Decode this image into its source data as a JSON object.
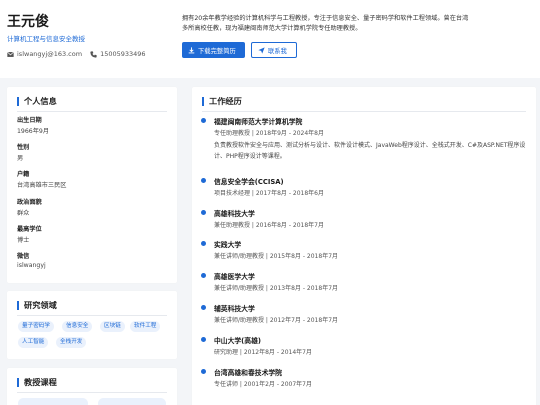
{
  "header": {
    "name": "王元俊",
    "subtitle": "计算机工程与信息安全教授",
    "email": "islwangyj@163.com",
    "phone": "15005933496",
    "intro": "拥有20余年教学经验的计算机科学与工程教授，专注于信息安全、量子密码学和软件工程领域。曾在台湾多所高校任教，现为福建闽南师范大学计算机学院专任助理教授。",
    "download_label": "下载完整简历",
    "contact_label": "联系我"
  },
  "personal": {
    "title": "个人信息",
    "fields": [
      {
        "label": "出生日期",
        "value": "1966年9月"
      },
      {
        "label": "性别",
        "value": "男"
      },
      {
        "label": "户籍",
        "value": "台湾高雄市三民区"
      },
      {
        "label": "政治面貌",
        "value": "群众"
      },
      {
        "label": "最高学位",
        "value": "博士"
      },
      {
        "label": "微信",
        "value": "islwangyj"
      }
    ]
  },
  "research": {
    "title": "研究领域",
    "tags": [
      "量子密码学",
      "信息安全",
      "区块链",
      "软件工程",
      "人工智能",
      "全栈开发"
    ]
  },
  "courses": {
    "title": "教授课程"
  },
  "work": {
    "title": "工作经历",
    "jobs": [
      {
        "org": "福建闽南师范大学计算机学院",
        "role": "专任助理教授 | 2018年9月 - 2024年8月",
        "desc": "负责教授软件安全与应用、测试分析与设计、软件设计模式、JavaWeb程序设计、全栈式开发、C#及ASP.NET程序设计、PHP程序设计等课程。"
      },
      {
        "org": "信息安全学会(CCISA)",
        "role": "项目技术经理 | 2017年8月 - 2018年6月"
      },
      {
        "org": "高雄科技大学",
        "role": "兼任助理教授 | 2016年8月 - 2018年7月"
      },
      {
        "org": "实践大学",
        "role": "兼任讲师/助理教授 | 2015年8月 - 2018年7月"
      },
      {
        "org": "高雄医学大学",
        "role": "兼任讲师/助理教授 | 2013年8月 - 2018年7月"
      },
      {
        "org": "辅英科技大学",
        "role": "兼任讲师/助理教授 | 2012年7月 - 2018年7月"
      },
      {
        "org": "中山大学(高雄)",
        "role": "研究助理 | 2012年8月 - 2014年7月"
      },
      {
        "org": "台湾高雄和春技术学院",
        "role": "专任讲师 | 2001年2月 - 2007年7月"
      }
    ]
  },
  "colors": {
    "accent": "#1e6ad6",
    "background": "#f3f5f8"
  }
}
